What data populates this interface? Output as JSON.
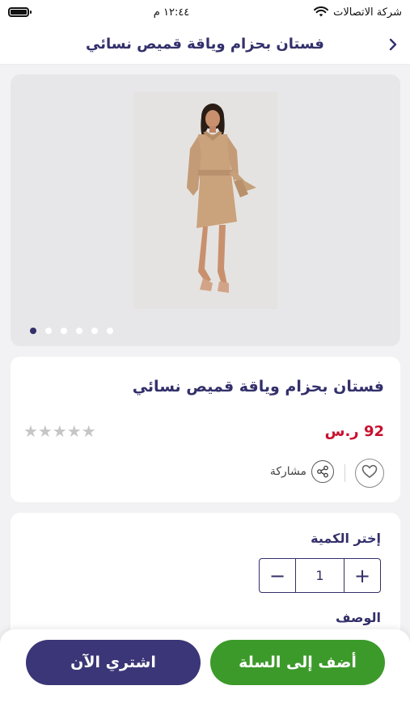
{
  "status_bar": {
    "carrier": "شركة الاتصالات",
    "time": "١٢:٤٤ م"
  },
  "header": {
    "title": "فستان بحزام وياقة قميص نسائي"
  },
  "gallery": {
    "image_count": 6,
    "active_index": 0
  },
  "product": {
    "title": "فستان بحزام وياقة قميص نسائي",
    "price": "92 ر.س",
    "rating": 0,
    "stars": "★★★★★",
    "share_label": "مشاركة"
  },
  "quantity": {
    "title": "إختر الكمية",
    "value": "1",
    "minus": "−",
    "plus": "+"
  },
  "description": {
    "title": "الوصف"
  },
  "actions": {
    "add_to_cart": "أضف إلى السلة",
    "buy_now": "اشتري الآن"
  },
  "colors": {
    "primary": "#33306b",
    "green": "#3c9a2a",
    "price_red": "#c8102e"
  }
}
